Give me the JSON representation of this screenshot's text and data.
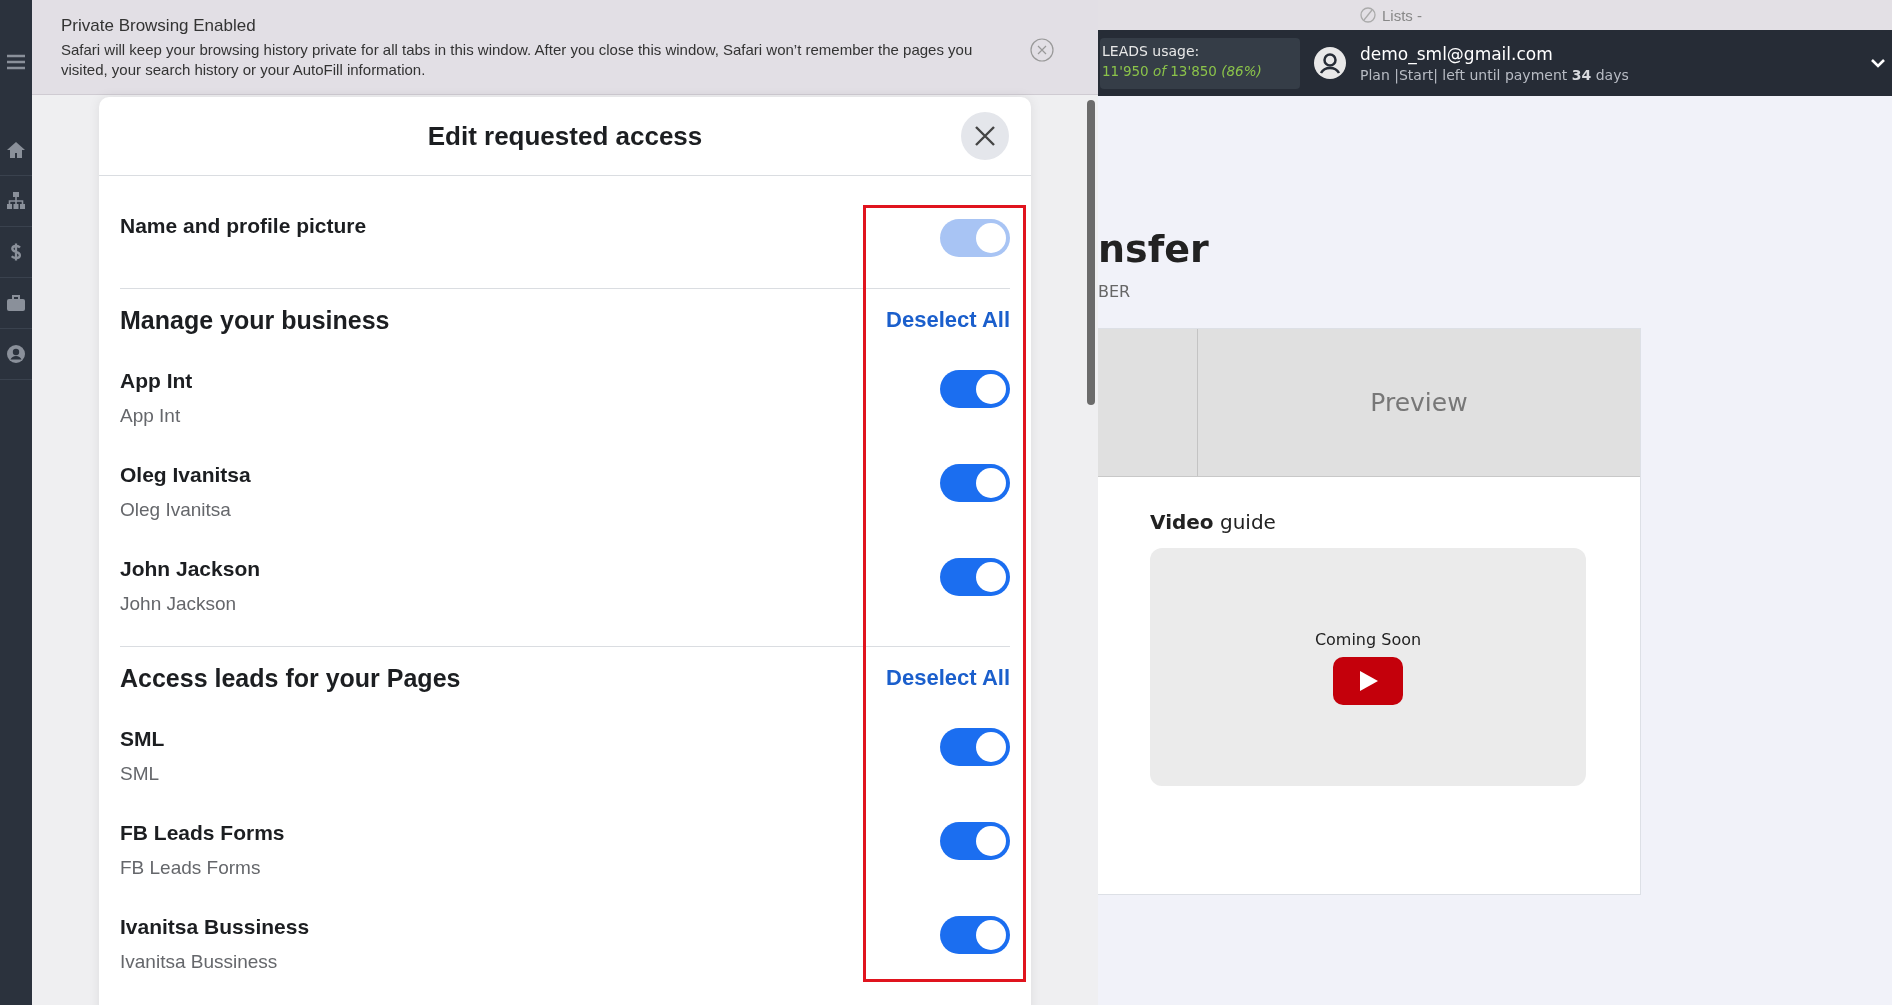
{
  "browser_tab": {
    "title": "Lists -"
  },
  "private_banner": {
    "title": "Private Browsing Enabled",
    "message": "Safari will keep your browsing history private for all tabs in this window. After you close this window, Safari won’t remember the pages you visited, your search history or your AutoFill information."
  },
  "header": {
    "usage_label": "LEADS usage:",
    "usage_value": "11'950 *of* 13'850 *(86%)*",
    "email": "demo_sml@gmail.com",
    "plan": "Plan |Start| left until payment **34** days"
  },
  "page": {
    "title_fragment": "nsfer",
    "subtitle_fragment": "BER",
    "tab_label": "Preview",
    "video_heading": "**Video** guide",
    "video_placeholder": "Coming Soon"
  },
  "modal": {
    "title": "Edit requested access",
    "profile": {
      "label": "Name and profile picture",
      "on": true,
      "disabled": true
    },
    "sections": [
      {
        "heading": "Manage your business",
        "action": "Deselect All",
        "items": [
          {
            "title": "App Int",
            "subtitle": "App Int",
            "on": true
          },
          {
            "title": "Oleg Ivanitsa",
            "subtitle": "Oleg Ivanitsa",
            "on": true
          },
          {
            "title": "John Jackson",
            "subtitle": "John Jackson",
            "on": true
          }
        ]
      },
      {
        "heading": "Access leads for your Pages",
        "action": "Deselect All",
        "items": [
          {
            "title": "SML",
            "subtitle": "SML",
            "on": true
          },
          {
            "title": "FB Leads Forms",
            "subtitle": "FB Leads Forms",
            "on": true
          },
          {
            "title": "Ivanitsa Bussiness",
            "subtitle": "Ivanitsa Bussiness",
            "on": true
          }
        ]
      }
    ]
  }
}
